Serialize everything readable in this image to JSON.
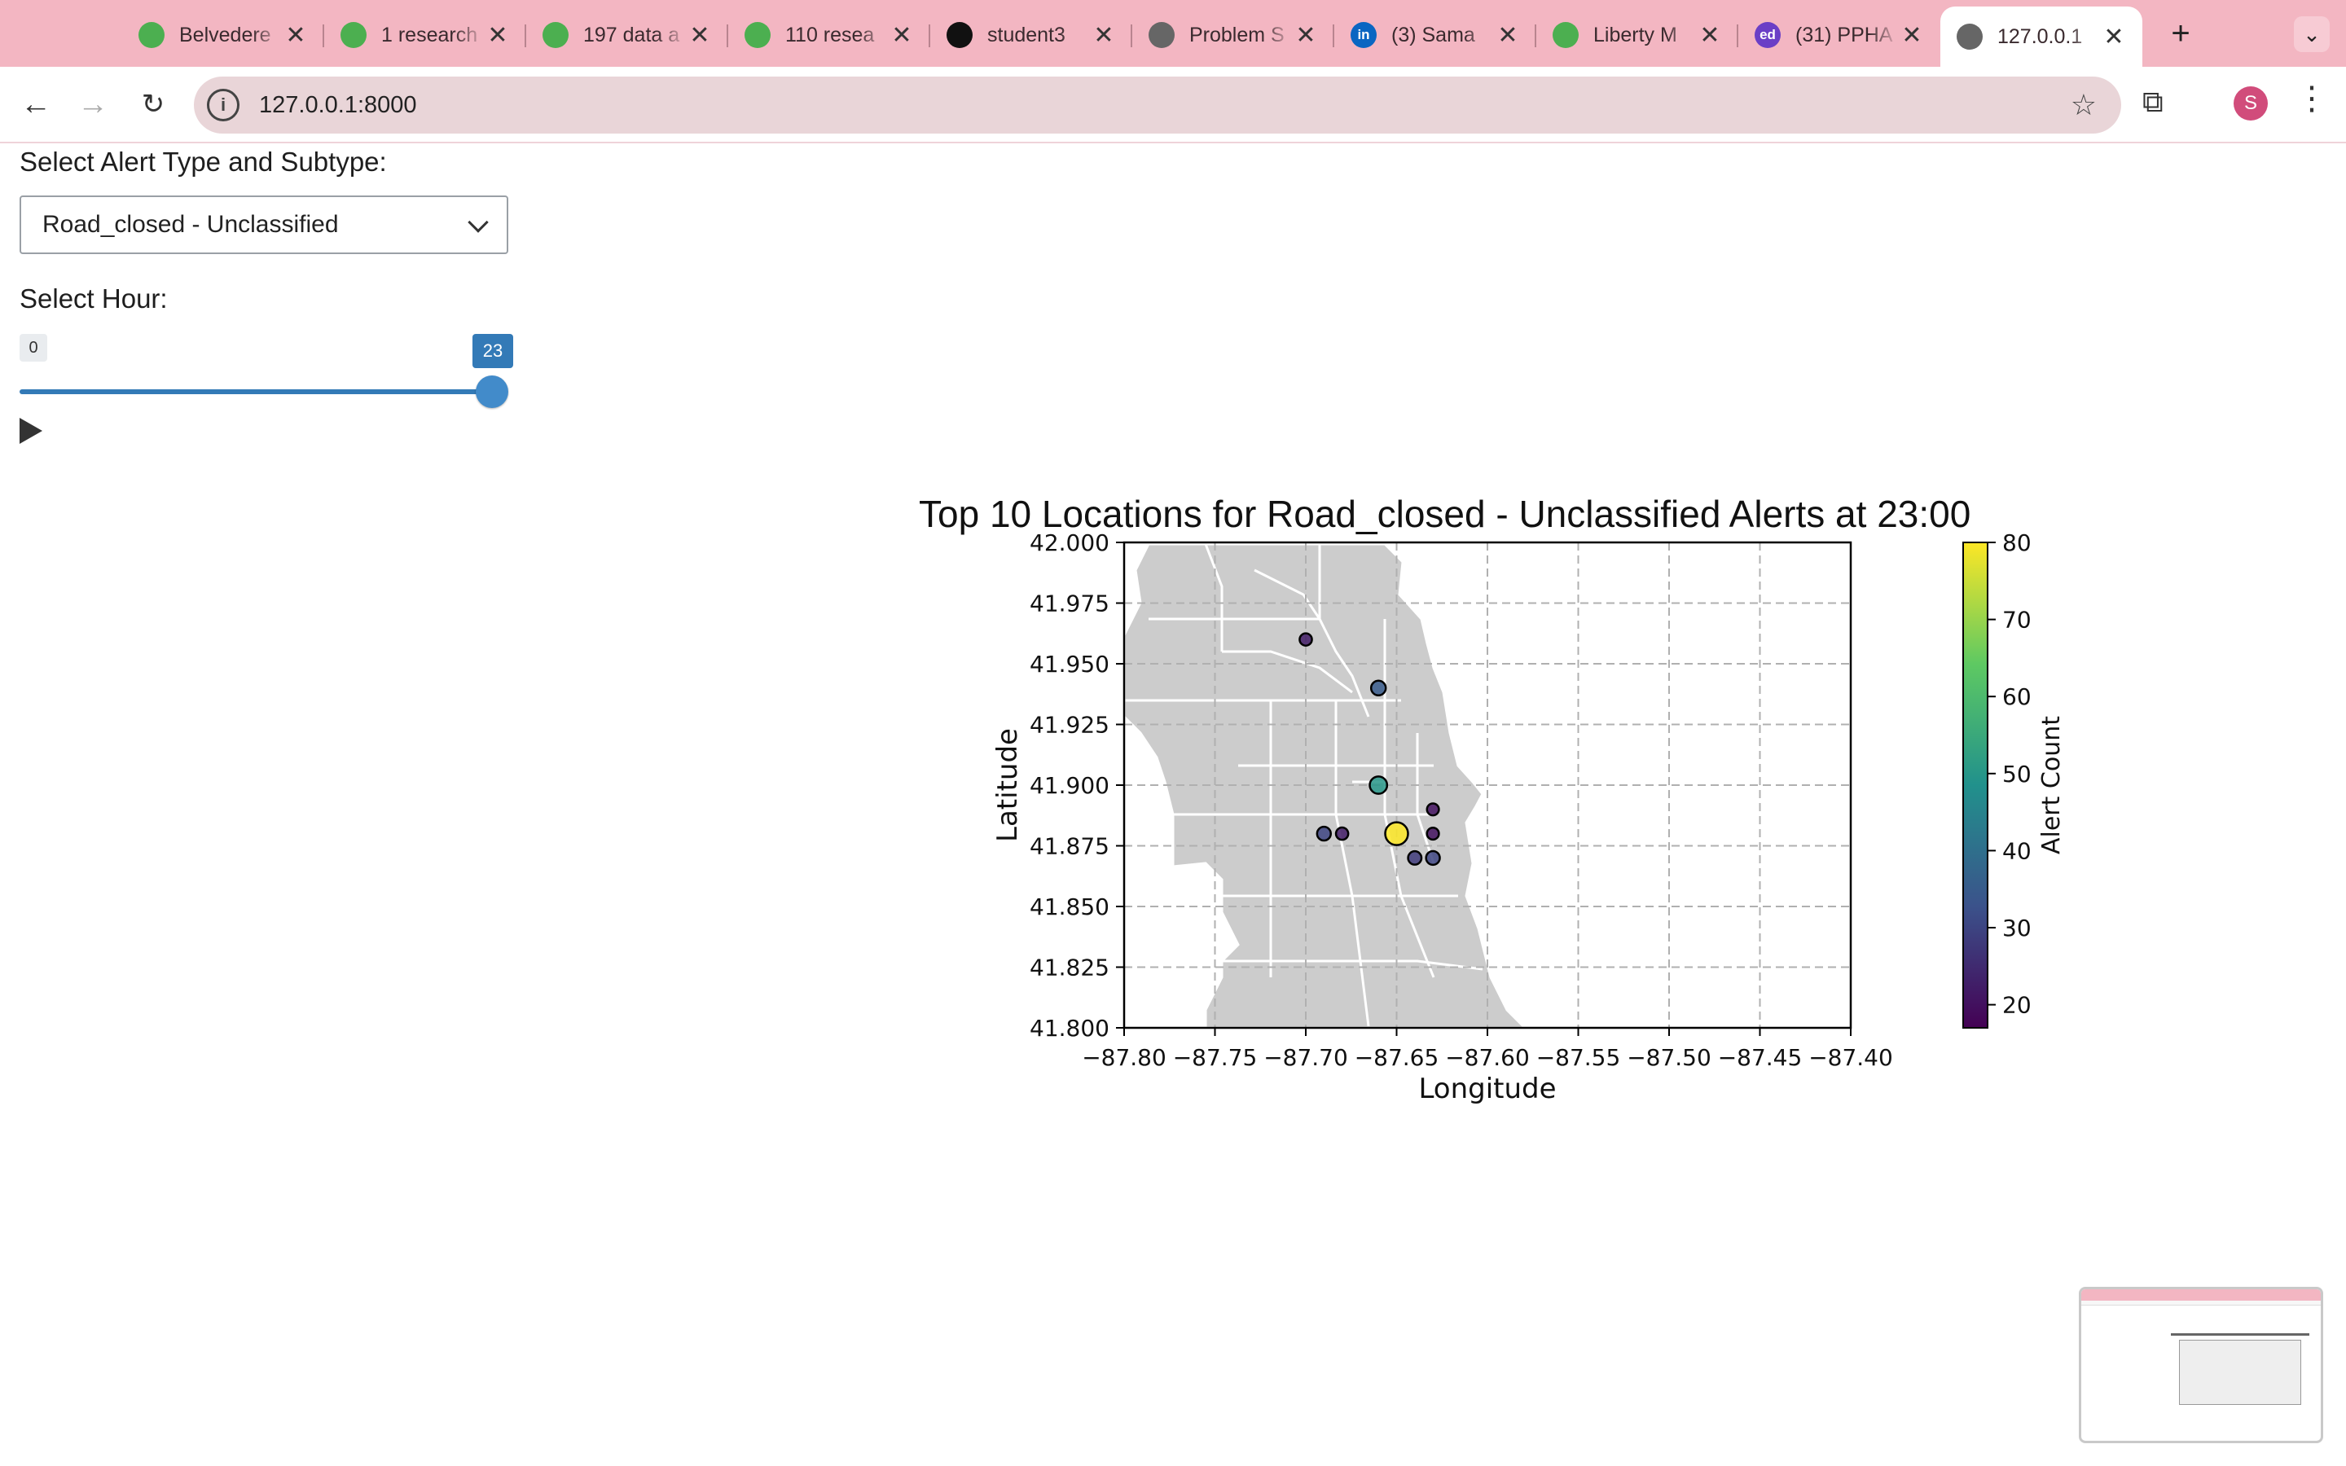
{
  "browser": {
    "tabs": [
      {
        "title": "Belvedere",
        "icon": "green-logo-icon",
        "color": "#4caf50"
      },
      {
        "title": "1 research",
        "icon": "green-logo-icon",
        "color": "#4caf50"
      },
      {
        "title": "197 data a",
        "icon": "green-logo-icon",
        "color": "#4caf50"
      },
      {
        "title": "110 resea",
        "icon": "green-logo-icon",
        "color": "#4caf50"
      },
      {
        "title": "student3",
        "icon": "github-icon",
        "color": "#111111"
      },
      {
        "title": "Problem S",
        "icon": "globe-icon",
        "color": "#666666"
      },
      {
        "title": "(3) Sama",
        "icon": "linkedin-icon",
        "color": "#0a66c2"
      },
      {
        "title": "Liberty M",
        "icon": "green-logo-icon",
        "color": "#4caf50"
      },
      {
        "title": "(31) PPHA",
        "icon": "ed-icon",
        "color": "#6a3fc6"
      },
      {
        "title": "127.0.0.1",
        "icon": "globe-icon",
        "color": "#666666"
      }
    ],
    "url": "127.0.0.1:8000",
    "profile_initial": "S",
    "close_glyph": "✕",
    "new_tab_glyph": "+"
  },
  "controls": {
    "alert_label": "Select Alert Type and Subtype:",
    "alert_selected": "Road_closed - Unclassified",
    "hour_label": "Select Hour:",
    "hour_min": "0",
    "hour_value": "23",
    "hour_min_value": 0,
    "hour_max_value": 23,
    "hour_current": 23
  },
  "chart_data": {
    "type": "scatter",
    "title": "Top 10 Locations for Road_closed - Unclassified Alerts at 23:00",
    "xlabel": "Longitude",
    "ylabel": "Latitude",
    "xlim": [
      -87.8,
      -87.4
    ],
    "ylim": [
      41.8,
      42.0
    ],
    "xticks": [
      "−87.80",
      "−87.75",
      "−87.70",
      "−87.65",
      "−87.60",
      "−87.55",
      "−87.50",
      "−87.45",
      "−87.40"
    ],
    "yticks": [
      "41.800",
      "41.825",
      "41.850",
      "41.875",
      "41.900",
      "41.925",
      "41.950",
      "41.975",
      "42.000"
    ],
    "grid": true,
    "colorbar": {
      "label": "Alert Count",
      "min": 17,
      "max": 80,
      "ticks": [
        "20",
        "30",
        "40",
        "50",
        "60",
        "70",
        "80"
      ],
      "colormap": "viridis"
    },
    "points": [
      {
        "x": -87.7,
        "y": 41.96,
        "count": 22
      },
      {
        "x": -87.66,
        "y": 41.94,
        "count": 35
      },
      {
        "x": -87.66,
        "y": 41.9,
        "count": 50
      },
      {
        "x": -87.63,
        "y": 41.89,
        "count": 20
      },
      {
        "x": -87.69,
        "y": 41.88,
        "count": 30
      },
      {
        "x": -87.68,
        "y": 41.88,
        "count": 22
      },
      {
        "x": -87.65,
        "y": 41.88,
        "count": 80
      },
      {
        "x": -87.63,
        "y": 41.88,
        "count": 20
      },
      {
        "x": -87.64,
        "y": 41.87,
        "count": 28
      },
      {
        "x": -87.63,
        "y": 41.87,
        "count": 30
      }
    ]
  }
}
